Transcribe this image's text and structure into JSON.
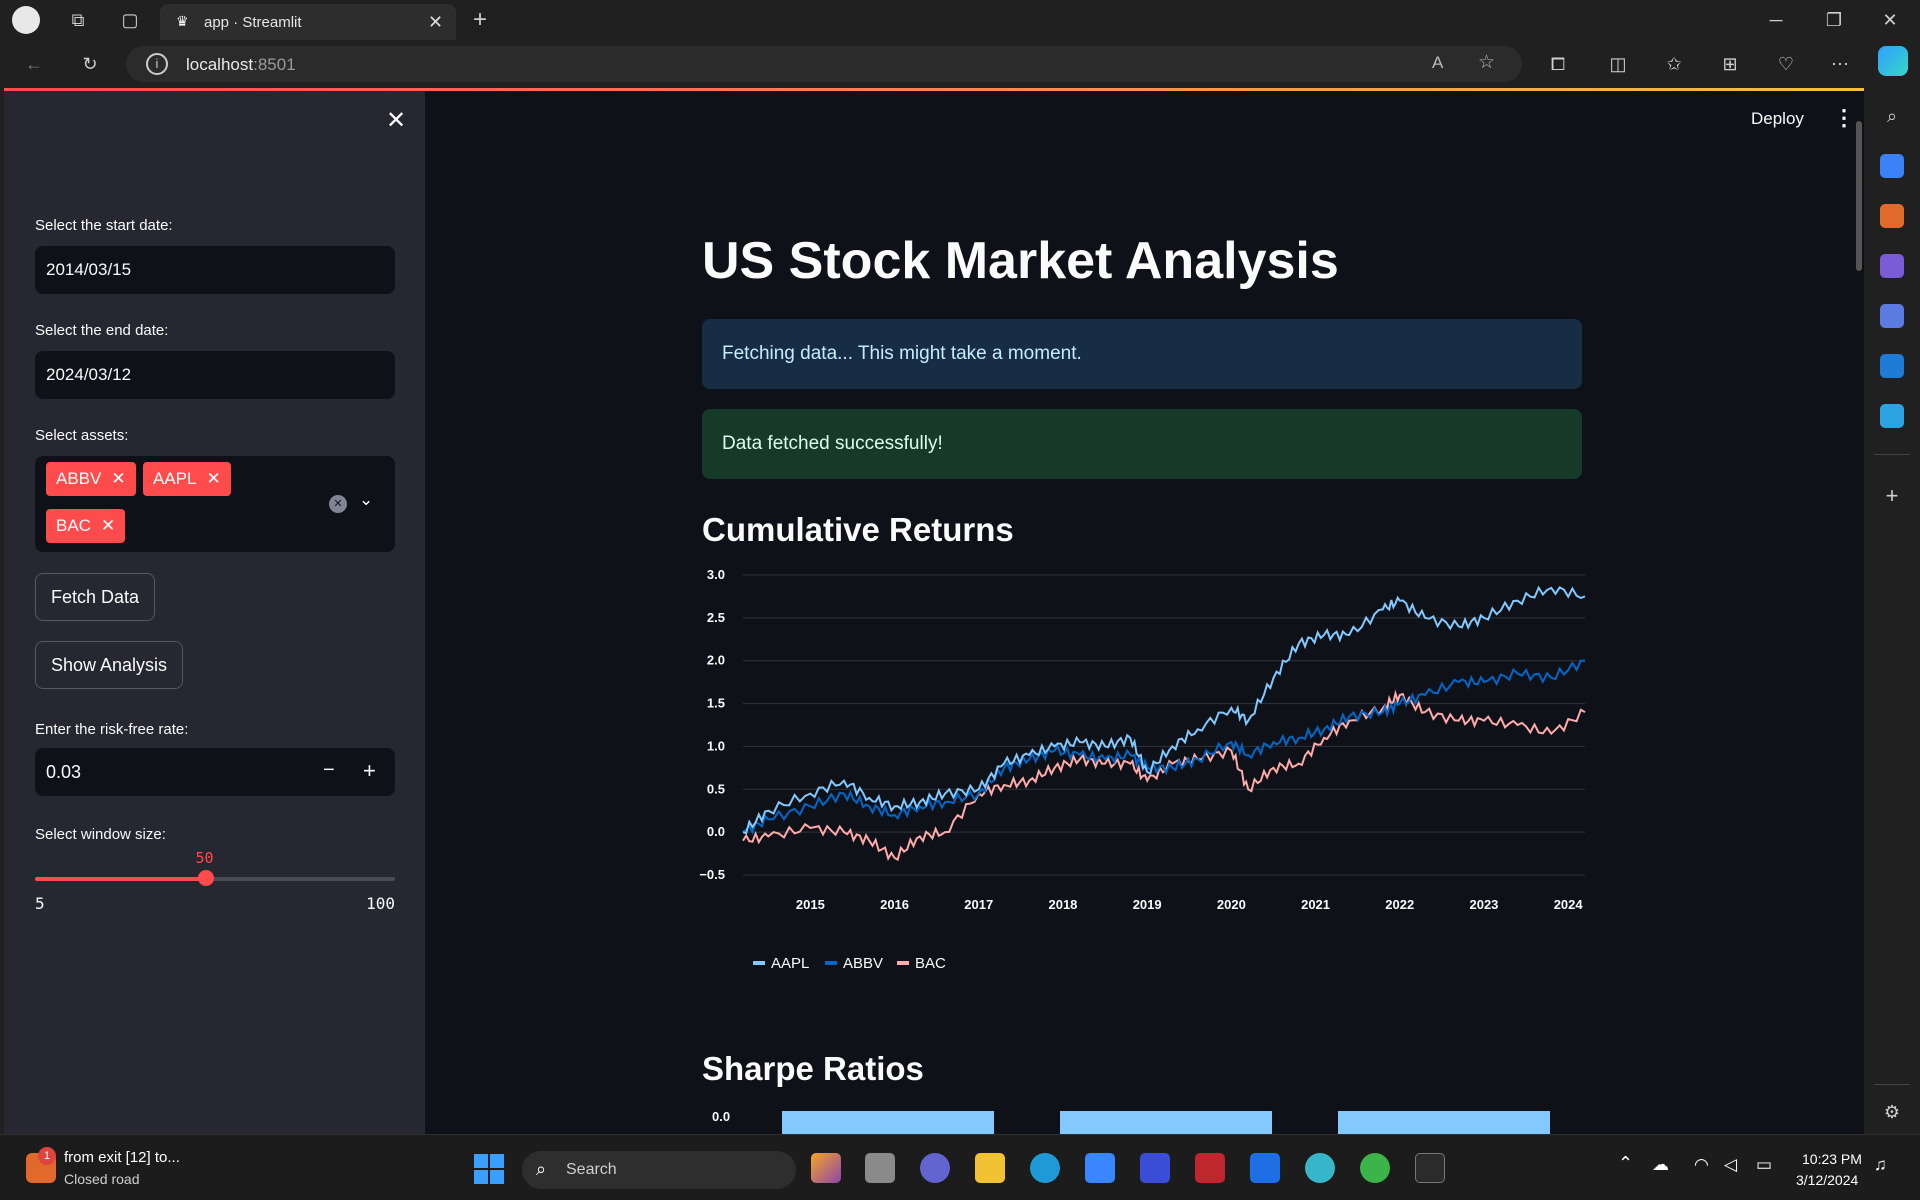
{
  "browser": {
    "tab_title": "app · Streamlit",
    "url_host": "localhost",
    "url_port": ":8501"
  },
  "sidebar": {
    "start_label": "Select the start date:",
    "start_value": "2014/03/15",
    "end_label": "Select the end date:",
    "end_value": "2024/03/12",
    "assets_label": "Select assets:",
    "assets": [
      "ABBV",
      "AAPL",
      "BAC"
    ],
    "fetch_button": "Fetch Data",
    "analysis_button": "Show Analysis",
    "risk_label": "Enter the risk-free rate:",
    "risk_value": "0.03",
    "window_label": "Select window size:",
    "window_value": "50",
    "window_min": "5",
    "window_max": "100",
    "window_fraction": 0.4737
  },
  "main": {
    "deploy": "Deploy",
    "title": "US Stock Market Analysis",
    "info_alert": "Fetching data... This might take a moment.",
    "success_alert": "Data fetched successfully!",
    "cumret_heading": "Cumulative Returns",
    "sharpe_heading": "Sharpe Ratios",
    "sharpe_tick": "0.0"
  },
  "colors": {
    "accent": "#ff4b4b",
    "aapl": "#83c9ff",
    "abbv": "#0068c9",
    "bac": "#ffabab",
    "info_bg": "#172d43",
    "info_text": "#c7ebff",
    "success_bg": "#173928",
    "success_text": "#dffde9"
  },
  "chart_data": {
    "type": "line",
    "title": "",
    "xlabel": "",
    "ylabel": "",
    "ylim": [
      -0.5,
      3.0
    ],
    "yticks": [
      "3.0",
      "2.5",
      "2.0",
      "1.5",
      "1.0",
      "0.5",
      "0.0",
      "−0.5"
    ],
    "xticks": [
      "2015",
      "2016",
      "2017",
      "2018",
      "2019",
      "2020",
      "2021",
      "2022",
      "2023",
      "2024"
    ],
    "legend_position": "bottom-left",
    "x": [
      2014.2,
      2014.5,
      2015.0,
      2015.4,
      2015.7,
      2016.0,
      2016.3,
      2016.6,
      2017.0,
      2017.3,
      2017.6,
      2017.9,
      2018.2,
      2018.5,
      2018.8,
      2019.0,
      2019.3,
      2019.6,
      2020.0,
      2020.2,
      2020.5,
      2020.8,
      2021.1,
      2021.4,
      2021.8,
      2022.0,
      2022.3,
      2022.7,
      2023.0,
      2023.4,
      2023.8,
      2024.2
    ],
    "series": [
      {
        "name": "AAPL",
        "color": "#83c9ff",
        "values": [
          0.0,
          0.25,
          0.45,
          0.6,
          0.4,
          0.3,
          0.35,
          0.45,
          0.5,
          0.8,
          0.9,
          1.0,
          1.05,
          1.0,
          1.1,
          0.7,
          1.0,
          1.2,
          1.45,
          1.3,
          1.8,
          2.2,
          2.3,
          2.3,
          2.6,
          2.7,
          2.5,
          2.4,
          2.5,
          2.7,
          2.85,
          2.75
        ]
      },
      {
        "name": "ABBV",
        "color": "#0068c9",
        "values": [
          0.0,
          0.15,
          0.3,
          0.45,
          0.3,
          0.2,
          0.3,
          0.35,
          0.45,
          0.75,
          0.85,
          0.95,
          0.9,
          0.85,
          0.9,
          0.75,
          0.75,
          0.85,
          1.05,
          0.9,
          1.05,
          1.1,
          1.2,
          1.35,
          1.4,
          1.5,
          1.6,
          1.75,
          1.75,
          1.85,
          1.8,
          2.0
        ]
      },
      {
        "name": "BAC",
        "color": "#ffabab",
        "values": [
          -0.1,
          -0.05,
          0.05,
          0.0,
          -0.1,
          -0.3,
          -0.05,
          0.0,
          0.45,
          0.55,
          0.6,
          0.75,
          0.85,
          0.8,
          0.8,
          0.6,
          0.8,
          0.85,
          0.95,
          0.5,
          0.75,
          0.8,
          1.1,
          1.3,
          1.45,
          1.6,
          1.4,
          1.3,
          1.3,
          1.25,
          1.15,
          1.4
        ]
      }
    ]
  }
}
